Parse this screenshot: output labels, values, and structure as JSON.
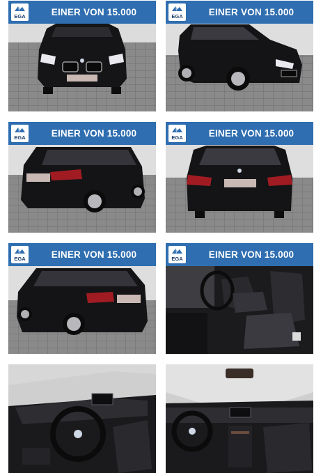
{
  "gallery": {
    "tiles": [
      {
        "banner": "EINER VON 15.000",
        "logo": "EGA"
      },
      {
        "banner": "EINER VON 15.000",
        "logo": "EGA"
      },
      {
        "banner": "EINER VON 15.000",
        "logo": "EGA"
      },
      {
        "banner": "EINER VON 15.000",
        "logo": "EGA"
      },
      {
        "banner": "EINER VON 15.000",
        "logo": "EGA"
      },
      {
        "banner": "EINER VON 15.000",
        "logo": "EGA"
      },
      {
        "banner": "",
        "logo": ""
      },
      {
        "banner": "",
        "logo": ""
      }
    ]
  },
  "colors": {
    "banner": "#2f6eb0",
    "car_body": "#141416",
    "floor": "#8e8e8e"
  }
}
